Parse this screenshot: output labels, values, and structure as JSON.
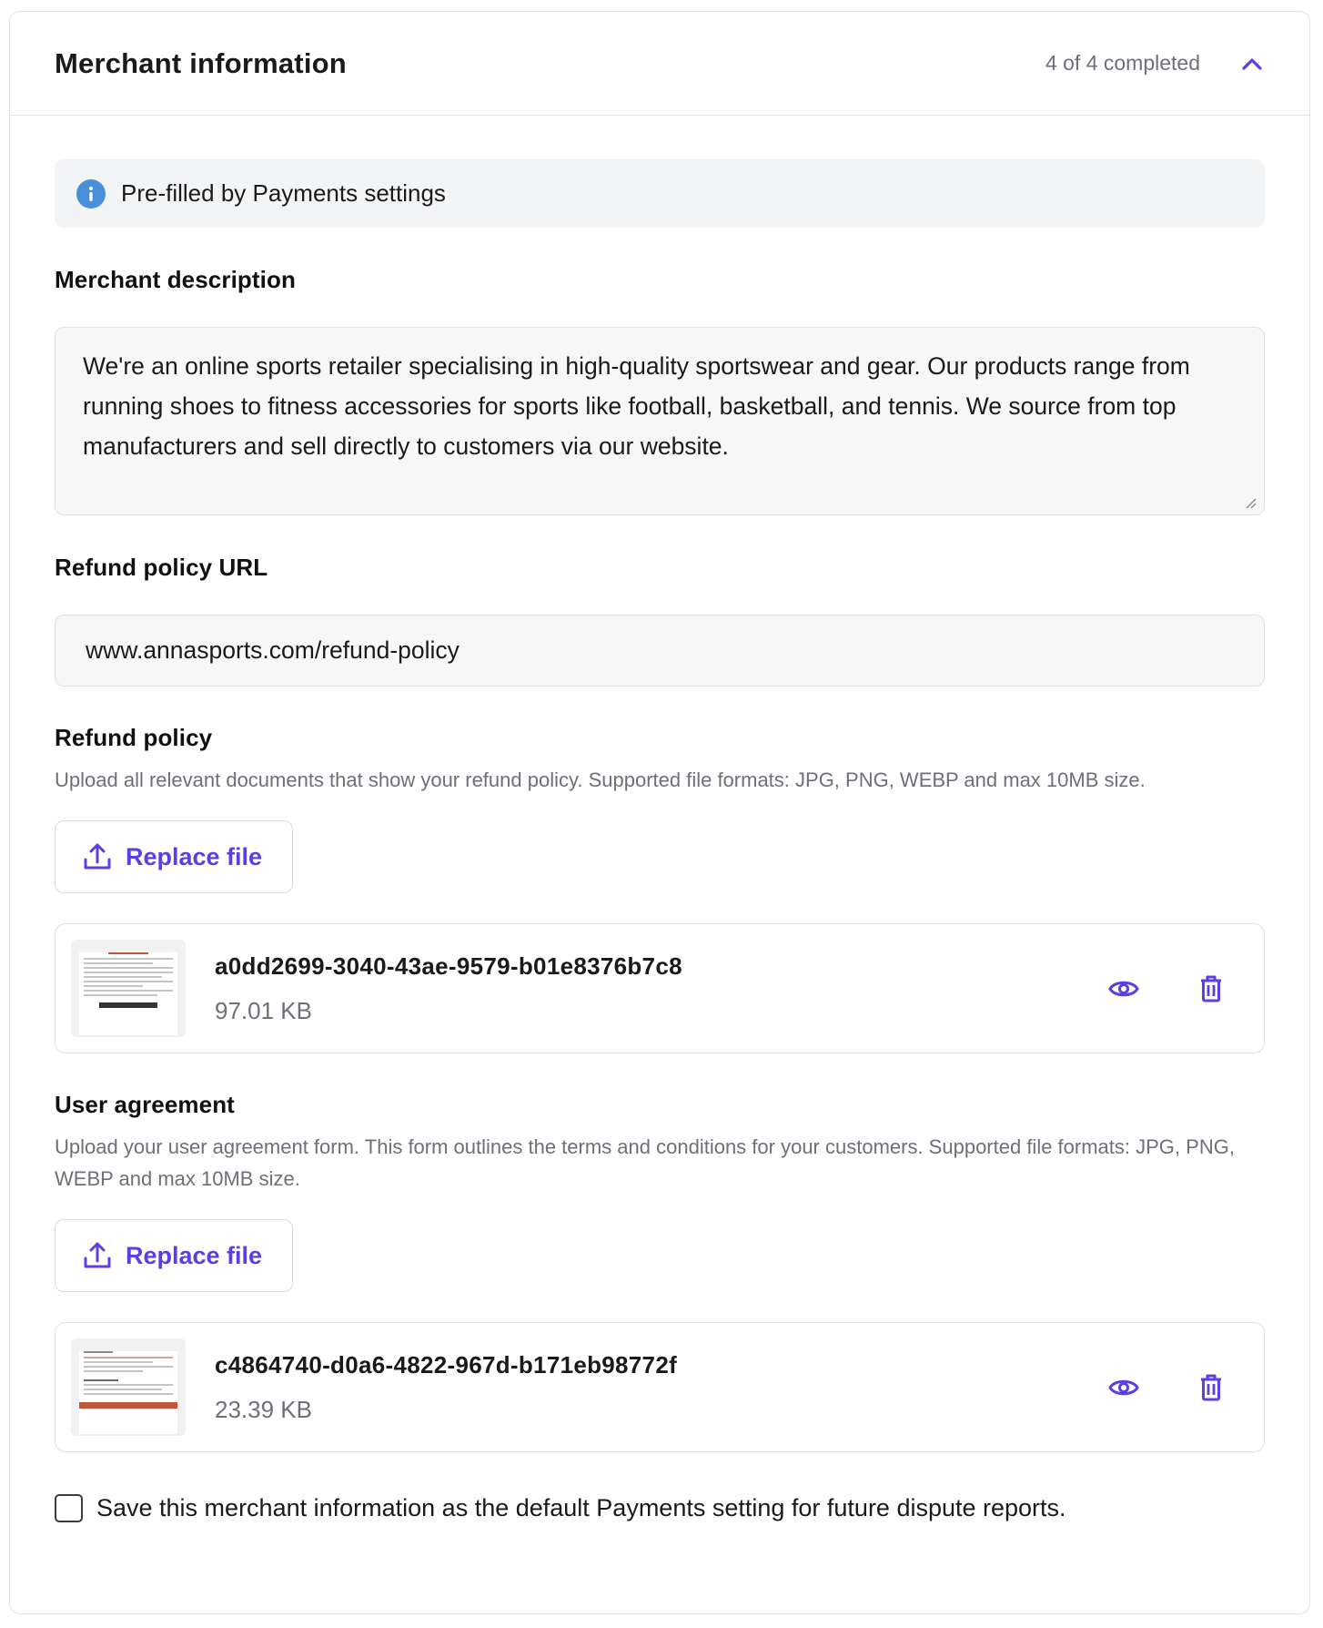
{
  "header": {
    "title": "Merchant information",
    "progress": "4 of 4 completed",
    "toggle_icon": "chevron-up-icon"
  },
  "banner": {
    "icon": "info-icon",
    "text": "Pre-filled by Payments settings"
  },
  "merchant_description": {
    "label": "Merchant description",
    "value": "We're an online sports retailer specialising in high-quality sportswear and gear. Our products range from running shoes to fitness accessories for sports like football, basketball, and tennis. We source from top manufacturers and sell directly to customers via our website."
  },
  "refund_url": {
    "label": "Refund policy URL",
    "value": "www.annasports.com/refund-policy"
  },
  "refund_policy": {
    "label": "Refund policy",
    "helper": "Upload all relevant documents that show your refund policy. Supported file formats: JPG, PNG, WEBP and max 10MB size.",
    "button_label": "Replace file",
    "file": {
      "name": "a0dd2699-3040-43ae-9579-b01e8376b7c8",
      "size": "97.01 KB"
    }
  },
  "user_agreement": {
    "label": "User agreement",
    "helper": "Upload your user agreement form. This form outlines the terms and conditions for your customers. Supported file formats: JPG, PNG, WEBP and max 10MB size.",
    "button_label": "Replace file",
    "file": {
      "name": "c4864740-d0a6-4822-967d-b171eb98772f",
      "size": "23.39 KB"
    }
  },
  "save_default": {
    "label": "Save this merchant information as the default Payments setting for future dispute reports.",
    "checked": false
  },
  "colors": {
    "accent": "#5b3fe6",
    "info": "#4a8fdc",
    "muted_text": "#6e6f78",
    "border": "#e3e4e8"
  }
}
